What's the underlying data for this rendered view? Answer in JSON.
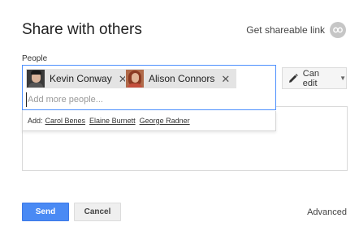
{
  "dialog": {
    "title": "Share with others",
    "shareable_link_label": "Get shareable link",
    "shareable_link_icon": "link-icon"
  },
  "people": {
    "label": "People",
    "chips": [
      {
        "name": "Kevin Conway",
        "remove": "✕"
      },
      {
        "name": "Alison Connors",
        "remove": "✕"
      }
    ],
    "input_value": "",
    "input_placeholder": "Add more people...",
    "suggestions_label": "Add:",
    "suggestions": [
      "Carol Benes",
      "Elaine Burnett",
      "George Radner"
    ]
  },
  "permission": {
    "label": "Can edit",
    "icon": "pencil-icon",
    "caret": "▼"
  },
  "actions": {
    "send": "Send",
    "cancel": "Cancel",
    "advanced": "Advanced"
  },
  "colors": {
    "primary": "#4a8af4",
    "focus_border": "#4d90fe",
    "chip_bg": "#e4e4e4"
  }
}
